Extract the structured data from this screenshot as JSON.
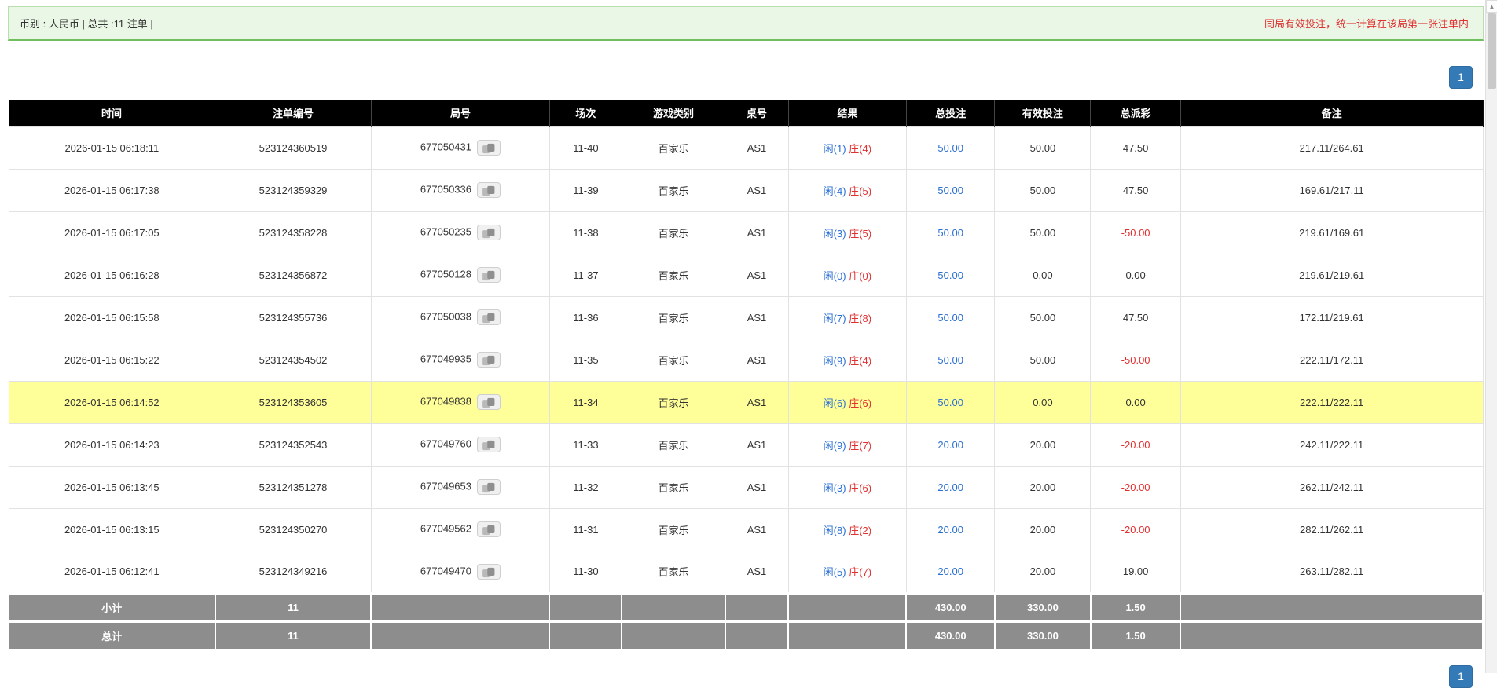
{
  "topbar": {
    "summary": "币别 : 人民币 | 总共 :11 注单 |",
    "notice": "同局有效投注，统一计算在该局第一张注单内"
  },
  "pagination": {
    "current_page": "1"
  },
  "scrollbar": {
    "up_arrow": "▲"
  },
  "colors": {
    "topbar_bg": "#eaf6e6",
    "topbar_border": "#6fbf5f",
    "topbar_border_light": "#b7dfae",
    "notice_red": "#e03030",
    "pagination_blue": "#337ab7",
    "pagination_border": "#2e6da4",
    "header_bg": "#000000",
    "footer_gray": "#8d8d8d",
    "highlight_yellow": "#ffff99",
    "link_blue": "#2a6fd4",
    "red": "#e03030"
  },
  "table": {
    "headers": [
      "时间",
      "注单编号",
      "局号",
      "场次",
      "游戏类别",
      "桌号",
      "结果",
      "总投注",
      "有效投注",
      "总派彩",
      "备注"
    ],
    "rows": [
      {
        "time": "2026-01-15 06:18:11",
        "bet_id": "523124360519",
        "round": "677050431",
        "session": "11-40",
        "game": "百家乐",
        "table_no": "AS1",
        "result_player": "闲(1)",
        "result_banker": "庄(4)",
        "total_bet": "50.00",
        "valid_bet": "50.00",
        "payout": "47.50",
        "remark": "217.11/264.61",
        "highlight": false
      },
      {
        "time": "2026-01-15 06:17:38",
        "bet_id": "523124359329",
        "round": "677050336",
        "session": "11-39",
        "game": "百家乐",
        "table_no": "AS1",
        "result_player": "闲(4)",
        "result_banker": "庄(5)",
        "total_bet": "50.00",
        "valid_bet": "50.00",
        "payout": "47.50",
        "remark": "169.61/217.11",
        "highlight": false
      },
      {
        "time": "2026-01-15 06:17:05",
        "bet_id": "523124358228",
        "round": "677050235",
        "session": "11-38",
        "game": "百家乐",
        "table_no": "AS1",
        "result_player": "闲(3)",
        "result_banker": "庄(5)",
        "total_bet": "50.00",
        "valid_bet": "50.00",
        "payout": "-50.00",
        "remark": "219.61/169.61",
        "highlight": false
      },
      {
        "time": "2026-01-15 06:16:28",
        "bet_id": "523124356872",
        "round": "677050128",
        "session": "11-37",
        "game": "百家乐",
        "table_no": "AS1",
        "result_player": "闲(0)",
        "result_banker": "庄(0)",
        "total_bet": "50.00",
        "valid_bet": "0.00",
        "payout": "0.00",
        "remark": "219.61/219.61",
        "highlight": false
      },
      {
        "time": "2026-01-15 06:15:58",
        "bet_id": "523124355736",
        "round": "677050038",
        "session": "11-36",
        "game": "百家乐",
        "table_no": "AS1",
        "result_player": "闲(7)",
        "result_banker": "庄(8)",
        "total_bet": "50.00",
        "valid_bet": "50.00",
        "payout": "47.50",
        "remark": "172.11/219.61",
        "highlight": false
      },
      {
        "time": "2026-01-15 06:15:22",
        "bet_id": "523124354502",
        "round": "677049935",
        "session": "11-35",
        "game": "百家乐",
        "table_no": "AS1",
        "result_player": "闲(9)",
        "result_banker": "庄(4)",
        "total_bet": "50.00",
        "valid_bet": "50.00",
        "payout": "-50.00",
        "remark": "222.11/172.11",
        "highlight": false
      },
      {
        "time": "2026-01-15 06:14:52",
        "bet_id": "523124353605",
        "round": "677049838",
        "session": "11-34",
        "game": "百家乐",
        "table_no": "AS1",
        "result_player": "闲(6)",
        "result_banker": "庄(6)",
        "total_bet": "50.00",
        "valid_bet": "0.00",
        "payout": "0.00",
        "remark": "222.11/222.11",
        "highlight": true
      },
      {
        "time": "2026-01-15 06:14:23",
        "bet_id": "523124352543",
        "round": "677049760",
        "session": "11-33",
        "game": "百家乐",
        "table_no": "AS1",
        "result_player": "闲(9)",
        "result_banker": "庄(7)",
        "total_bet": "20.00",
        "valid_bet": "20.00",
        "payout": "-20.00",
        "remark": "242.11/222.11",
        "highlight": false
      },
      {
        "time": "2026-01-15 06:13:45",
        "bet_id": "523124351278",
        "round": "677049653",
        "session": "11-32",
        "game": "百家乐",
        "table_no": "AS1",
        "result_player": "闲(3)",
        "result_banker": "庄(6)",
        "total_bet": "20.00",
        "valid_bet": "20.00",
        "payout": "-20.00",
        "remark": "262.11/242.11",
        "highlight": false
      },
      {
        "time": "2026-01-15 06:13:15",
        "bet_id": "523124350270",
        "round": "677049562",
        "session": "11-31",
        "game": "百家乐",
        "table_no": "AS1",
        "result_player": "闲(8)",
        "result_banker": "庄(2)",
        "total_bet": "20.00",
        "valid_bet": "20.00",
        "payout": "-20.00",
        "remark": "282.11/262.11",
        "highlight": false
      },
      {
        "time": "2026-01-15 06:12:41",
        "bet_id": "523124349216",
        "round": "677049470",
        "session": "11-30",
        "game": "百家乐",
        "table_no": "AS1",
        "result_player": "闲(5)",
        "result_banker": "庄(7)",
        "total_bet": "20.00",
        "valid_bet": "20.00",
        "payout": "19.00",
        "remark": "263.11/282.11",
        "highlight": false
      }
    ],
    "subtotal": {
      "label": "小计",
      "count": "11",
      "total_bet": "430.00",
      "valid_bet": "330.00",
      "payout": "1.50"
    },
    "total": {
      "label": "总计",
      "count": "11",
      "total_bet": "430.00",
      "valid_bet": "330.00",
      "payout": "1.50"
    }
  }
}
